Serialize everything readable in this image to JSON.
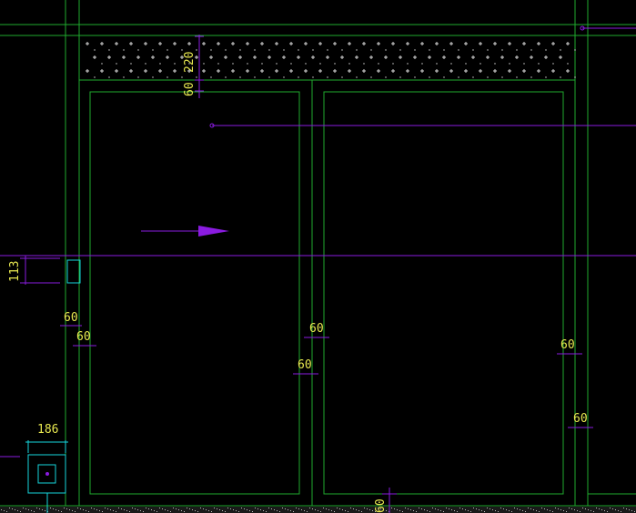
{
  "colors": {
    "background": "#000000",
    "frame": "#1faa2e",
    "dimension": "#8a1be0",
    "text": "#e8e850",
    "cyan": "#16d6dc",
    "hatch": "#d8d8d8"
  },
  "dimensions": {
    "transom_height": "220",
    "transom_frame": "60",
    "side_offset": "113",
    "left_frame_a": "60",
    "left_frame_b": "60",
    "center_mullion_a": "60",
    "center_mullion_b": "60",
    "right_frame_a": "60",
    "right_frame_b": "60",
    "bottom_frame": "60",
    "column_width": "186"
  }
}
